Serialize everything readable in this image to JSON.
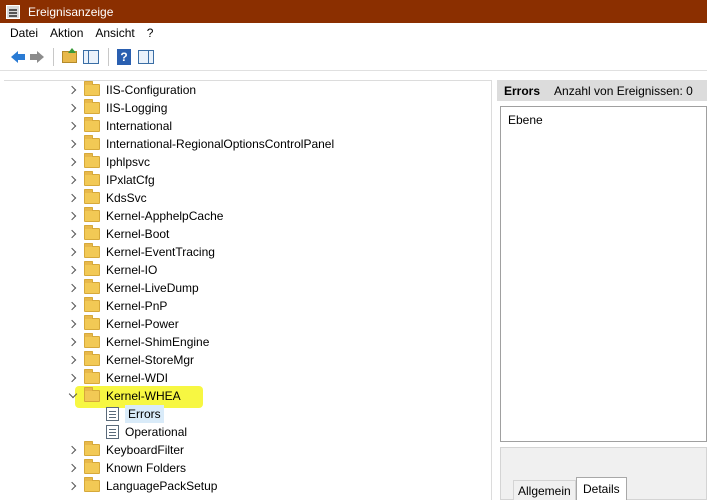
{
  "window": {
    "title": "Ereignisanzeige"
  },
  "menu": [
    "Datei",
    "Aktion",
    "Ansicht",
    "?"
  ],
  "toolbar": {
    "buttons": [
      "back-arrow-icon",
      "forward-arrow-icon",
      "folder-up-icon",
      "show-hide-tree-icon",
      "help-icon",
      "show-hide-action-pane-icon"
    ]
  },
  "tree": {
    "items": [
      {
        "label": "IIS-Configuration"
      },
      {
        "label": "IIS-Logging"
      },
      {
        "label": "International"
      },
      {
        "label": "International-RegionalOptionsControlPanel"
      },
      {
        "label": "Iphlpsvc"
      },
      {
        "label": "IPxlatCfg"
      },
      {
        "label": "KdsSvc"
      },
      {
        "label": "Kernel-ApphelpCache"
      },
      {
        "label": "Kernel-Boot"
      },
      {
        "label": "Kernel-EventTracing"
      },
      {
        "label": "Kernel-IO"
      },
      {
        "label": "Kernel-LiveDump"
      },
      {
        "label": "Kernel-PnP"
      },
      {
        "label": "Kernel-Power"
      },
      {
        "label": "Kernel-ShimEngine"
      },
      {
        "label": "Kernel-StoreMgr"
      },
      {
        "label": "Kernel-WDI"
      },
      {
        "label": "Kernel-WHEA",
        "expanded": true,
        "highlight_color": "#f7f738"
      }
    ],
    "children": [
      {
        "label": "Errors",
        "selected": true
      },
      {
        "label": "Operational"
      }
    ],
    "after": [
      {
        "label": "KeyboardFilter"
      },
      {
        "label": "Known Folders"
      },
      {
        "label": "LanguagePackSetup"
      }
    ]
  },
  "right_pane": {
    "title": "Errors",
    "event_count": "Anzahl von Ereignissen: 0",
    "column_header": "Ebene",
    "tabs": [
      "Allgemein",
      "Details"
    ]
  },
  "colors": {
    "titlebar": "#8b2f00",
    "selection": "#d9ebf9"
  }
}
